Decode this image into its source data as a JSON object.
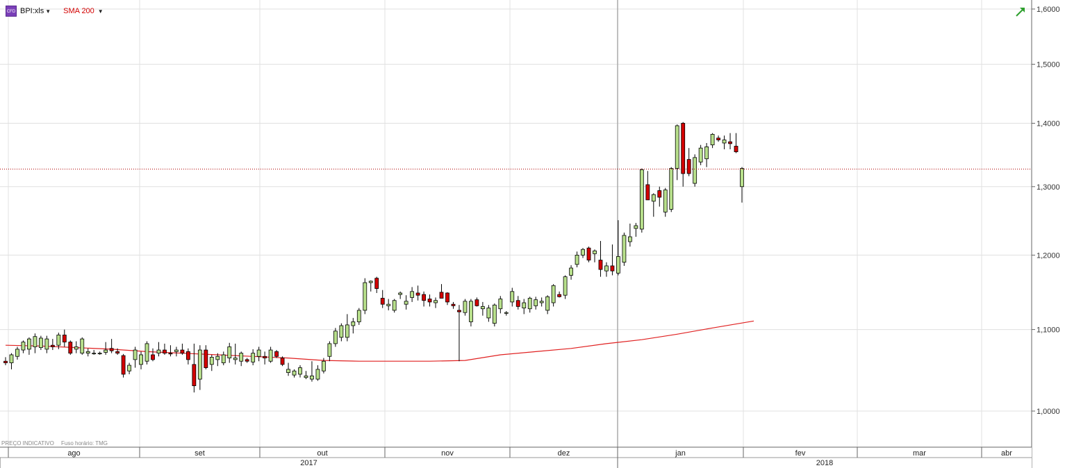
{
  "toolbar": {
    "symbol_icon_text": "CFD",
    "symbol": "BPI:xls",
    "indicator": "SMA 200",
    "indicator_color": "#d40000"
  },
  "footnote": {
    "price_note": "PREÇO INDICATIVO",
    "timezone_note": "Fuso horário: TMG"
  },
  "colors": {
    "up": "#b8e08c",
    "down": "#d40000",
    "sma": "#e02020",
    "grid": "#e0e0e0",
    "current_price_line": "#b00000"
  },
  "chart_data": {
    "type": "candlestick",
    "y_axis": {
      "ticks": [
        1.0,
        1.1,
        1.2,
        1.3,
        1.4,
        1.5,
        1.6
      ],
      "tick_labels": [
        "1,0000",
        "1,1000",
        "1,2000",
        "1,3000",
        "1,4000",
        "1,5000",
        "1,6000"
      ],
      "scale": "log",
      "position": "right"
    },
    "x_axis": {
      "months": [
        "ago",
        "set",
        "out",
        "nov",
        "dez",
        "jan",
        "fev",
        "mar",
        "abr"
      ],
      "years": [
        "2017",
        "2018"
      ]
    },
    "current_price": 1.327,
    "series": [
      {
        "name": "BPI:xls",
        "type": "candlestick",
        "candles": [
          [
            1.06,
            1.065,
            1.055,
            1.058
          ],
          [
            1.058,
            1.07,
            1.05,
            1.068
          ],
          [
            1.066,
            1.078,
            1.062,
            1.075
          ],
          [
            1.074,
            1.086,
            1.07,
            1.084
          ],
          [
            1.075,
            1.09,
            1.068,
            1.088
          ],
          [
            1.078,
            1.095,
            1.07,
            1.091
          ],
          [
            1.077,
            1.092,
            1.074,
            1.089
          ],
          [
            1.075,
            1.092,
            1.07,
            1.088
          ],
          [
            1.08,
            1.088,
            1.074,
            1.078
          ],
          [
            1.08,
            1.096,
            1.075,
            1.093
          ],
          [
            1.093,
            1.1,
            1.078,
            1.084
          ],
          [
            1.084,
            1.086,
            1.068,
            1.07
          ],
          [
            1.075,
            1.085,
            1.07,
            1.078
          ],
          [
            1.07,
            1.09,
            1.068,
            1.088
          ],
          [
            1.07,
            1.076,
            1.066,
            1.072
          ],
          [
            1.07,
            1.074,
            1.068,
            1.07
          ],
          [
            1.07,
            1.072,
            1.068,
            1.07
          ],
          [
            1.071,
            1.084,
            1.068,
            1.074
          ],
          [
            1.076,
            1.088,
            1.07,
            1.073
          ],
          [
            1.072,
            1.076,
            1.068,
            1.07
          ],
          [
            1.067,
            1.069,
            1.04,
            1.044
          ],
          [
            1.048,
            1.058,
            1.044,
            1.055
          ],
          [
            1.062,
            1.078,
            1.052,
            1.074
          ],
          [
            1.056,
            1.072,
            1.05,
            1.068
          ],
          [
            1.06,
            1.085,
            1.056,
            1.082
          ],
          [
            1.068,
            1.076,
            1.06,
            1.062
          ],
          [
            1.07,
            1.084,
            1.066,
            1.074
          ],
          [
            1.074,
            1.082,
            1.068,
            1.07
          ],
          [
            1.07,
            1.08,
            1.066,
            1.069
          ],
          [
            1.072,
            1.078,
            1.066,
            1.074
          ],
          [
            1.074,
            1.082,
            1.068,
            1.07
          ],
          [
            1.072,
            1.076,
            1.056,
            1.062
          ],
          [
            1.056,
            1.082,
            1.022,
            1.03
          ],
          [
            1.038,
            1.08,
            1.025,
            1.074
          ],
          [
            1.074,
            1.08,
            1.05,
            1.052
          ],
          [
            1.056,
            1.068,
            1.048,
            1.065
          ],
          [
            1.062,
            1.07,
            1.054,
            1.066
          ],
          [
            1.058,
            1.072,
            1.055,
            1.068
          ],
          [
            1.064,
            1.083,
            1.058,
            1.078
          ],
          [
            1.062,
            1.082,
            1.056,
            1.064
          ],
          [
            1.06,
            1.072,
            1.054,
            1.07
          ],
          [
            1.062,
            1.064,
            1.058,
            1.06
          ],
          [
            1.059,
            1.075,
            1.055,
            1.07
          ],
          [
            1.066,
            1.078,
            1.06,
            1.074
          ],
          [
            1.066,
            1.072,
            1.056,
            1.064
          ],
          [
            1.06,
            1.078,
            1.058,
            1.074
          ],
          [
            1.072,
            1.074,
            1.064,
            1.066
          ],
          [
            1.064,
            1.066,
            1.054,
            1.056
          ],
          [
            1.046,
            1.058,
            1.042,
            1.05
          ],
          [
            1.043,
            1.05,
            1.04,
            1.048
          ],
          [
            1.044,
            1.055,
            1.04,
            1.052
          ],
          [
            1.04,
            1.048,
            1.038,
            1.042
          ],
          [
            1.038,
            1.06,
            1.035,
            1.042
          ],
          [
            1.038,
            1.055,
            1.036,
            1.05
          ],
          [
            1.048,
            1.064,
            1.045,
            1.06
          ],
          [
            1.066,
            1.085,
            1.06,
            1.082
          ],
          [
            1.082,
            1.102,
            1.078,
            1.098
          ],
          [
            1.09,
            1.108,
            1.085,
            1.105
          ],
          [
            1.09,
            1.12,
            1.085,
            1.106
          ],
          [
            1.105,
            1.115,
            1.095,
            1.11
          ],
          [
            1.11,
            1.128,
            1.106,
            1.125
          ],
          [
            1.125,
            1.168,
            1.12,
            1.162
          ],
          [
            1.162,
            1.165,
            1.15,
            1.164
          ],
          [
            1.168,
            1.17,
            1.148,
            1.154
          ],
          [
            1.141,
            1.152,
            1.128,
            1.133
          ],
          [
            1.131,
            1.14,
            1.125,
            1.133
          ],
          [
            1.125,
            1.14,
            1.122,
            1.138
          ],
          [
            1.146,
            1.15,
            1.14,
            1.148
          ],
          [
            1.133,
            1.145,
            1.126,
            1.137
          ],
          [
            1.142,
            1.156,
            1.136,
            1.15
          ],
          [
            1.148,
            1.158,
            1.138,
            1.145
          ],
          [
            1.146,
            1.15,
            1.13,
            1.138
          ],
          [
            1.14,
            1.146,
            1.13,
            1.136
          ],
          [
            1.135,
            1.142,
            1.128,
            1.138
          ],
          [
            1.149,
            1.16,
            1.141,
            1.141
          ],
          [
            1.148,
            1.149,
            1.132,
            1.136
          ],
          [
            1.133,
            1.136,
            1.127,
            1.131
          ],
          [
            1.125,
            1.132,
            1.06,
            1.123
          ],
          [
            1.122,
            1.14,
            1.118,
            1.137
          ],
          [
            1.11,
            1.14,
            1.104,
            1.137
          ],
          [
            1.139,
            1.142,
            1.13,
            1.131
          ],
          [
            1.127,
            1.136,
            1.118,
            1.13
          ],
          [
            1.115,
            1.132,
            1.11,
            1.128
          ],
          [
            1.108,
            1.134,
            1.104,
            1.132
          ],
          [
            1.127,
            1.144,
            1.121,
            1.14
          ],
          [
            1.121,
            1.124,
            1.118,
            1.122
          ],
          [
            1.136,
            1.155,
            1.13,
            1.15
          ],
          [
            1.138,
            1.144,
            1.126,
            1.13
          ],
          [
            1.128,
            1.14,
            1.12,
            1.135
          ],
          [
            1.127,
            1.143,
            1.122,
            1.141
          ],
          [
            1.131,
            1.143,
            1.126,
            1.139
          ],
          [
            1.135,
            1.142,
            1.13,
            1.137
          ],
          [
            1.125,
            1.145,
            1.12,
            1.143
          ],
          [
            1.135,
            1.16,
            1.13,
            1.158
          ],
          [
            1.146,
            1.15,
            1.142,
            1.143
          ],
          [
            1.145,
            1.172,
            1.14,
            1.17
          ],
          [
            1.172,
            1.186,
            1.166,
            1.182
          ],
          [
            1.187,
            1.205,
            1.183,
            1.2
          ],
          [
            1.2,
            1.21,
            1.196,
            1.208
          ],
          [
            1.21,
            1.212,
            1.19,
            1.193
          ],
          [
            1.202,
            1.208,
            1.19,
            1.206
          ],
          [
            1.193,
            1.22,
            1.17,
            1.18
          ],
          [
            1.178,
            1.19,
            1.17,
            1.185
          ],
          [
            1.185,
            1.215,
            1.172,
            1.178
          ],
          [
            1.175,
            1.25,
            1.172,
            1.198
          ],
          [
            1.19,
            1.232,
            1.185,
            1.228
          ],
          [
            1.219,
            1.245,
            1.212,
            1.226
          ],
          [
            1.238,
            1.246,
            1.226,
            1.242
          ],
          [
            1.237,
            1.328,
            1.232,
            1.326
          ],
          [
            1.303,
            1.324,
            1.28,
            1.28
          ],
          [
            1.278,
            1.29,
            1.255,
            1.288
          ],
          [
            1.294,
            1.3,
            1.27,
            1.284
          ],
          [
            1.262,
            1.298,
            1.255,
            1.295
          ],
          [
            1.266,
            1.33,
            1.262,
            1.328
          ],
          [
            1.328,
            1.398,
            1.31,
            1.396
          ],
          [
            1.4,
            1.402,
            1.3,
            1.32
          ],
          [
            1.342,
            1.36,
            1.316,
            1.32
          ],
          [
            1.305,
            1.35,
            1.3,
            1.345
          ],
          [
            1.338,
            1.365,
            1.333,
            1.36
          ],
          [
            1.343,
            1.368,
            1.33,
            1.362
          ],
          [
            1.365,
            1.384,
            1.36,
            1.382
          ],
          [
            1.376,
            1.38,
            1.37,
            1.373
          ],
          [
            1.368,
            1.38,
            1.358,
            1.373
          ],
          [
            1.37,
            1.384,
            1.358,
            1.367
          ],
          [
            1.363,
            1.384,
            1.352,
            1.354
          ],
          [
            1.3,
            1.33,
            1.276,
            1.328
          ]
        ]
      },
      {
        "name": "SMA 200",
        "type": "line",
        "values_by_candle": [
          [
            0,
            1.08
          ],
          [
            6,
            1.079
          ],
          [
            12,
            1.077
          ],
          [
            18,
            1.075
          ],
          [
            24,
            1.072
          ],
          [
            30,
            1.07
          ],
          [
            36,
            1.068
          ],
          [
            42,
            1.066
          ],
          [
            48,
            1.064
          ],
          [
            54,
            1.061
          ],
          [
            60,
            1.06
          ],
          [
            66,
            1.06
          ],
          [
            72,
            1.06
          ],
          [
            78,
            1.061
          ],
          [
            84,
            1.068
          ],
          [
            90,
            1.072
          ],
          [
            96,
            1.076
          ],
          [
            102,
            1.082
          ],
          [
            108,
            1.087
          ],
          [
            114,
            1.094
          ],
          [
            120,
            1.102
          ],
          [
            127,
            1.111
          ]
        ]
      }
    ]
  }
}
